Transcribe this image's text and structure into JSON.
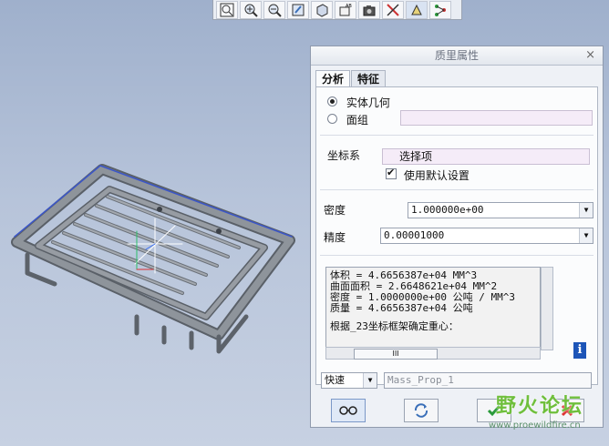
{
  "toolbar": {
    "icons": [
      "zoom-fit-icon",
      "zoom-in-icon",
      "zoom-out-icon",
      "repaint-icon",
      "shading-icon",
      "named-view-icon",
      "camera-icon",
      "spin-center-icon",
      "datum-display-icon",
      "tree-icon"
    ]
  },
  "dialog": {
    "title": "质里属性",
    "close": "×",
    "tabs": [
      "分析",
      "特征"
    ],
    "radio_solid": "实体几何",
    "radio_quilt": "面组",
    "csys_label": "坐标系",
    "csys_value": "选择项",
    "use_default": "使用默认设置",
    "density_label": "密度",
    "density_value": "1.000000e+00",
    "accuracy_label": "精度",
    "accuracy_value": "0.00001000",
    "results": [
      "体积 =  4.6656387e+04  MM^3",
      "曲面面积 =  2.6648621e+04  MM^2",
      "密度 =  1.0000000e+00 公吨 / MM^3",
      "质量 =  4.6656387e+04 公吨"
    ],
    "results_note": "根据_23坐标框架确定重心：",
    "hscroll_label": "III",
    "info": "i",
    "mode_value": "快速",
    "name_value": "Mass_Prop_1"
  },
  "watermark": {
    "text": "野火论坛",
    "url": "www.proewildfire.cn"
  }
}
